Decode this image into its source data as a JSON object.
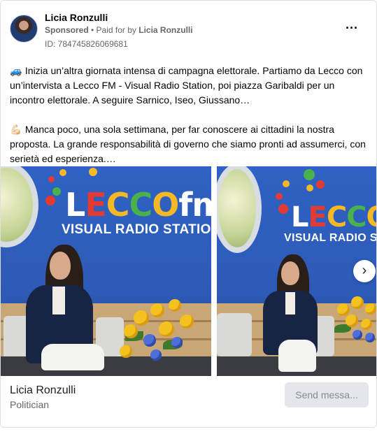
{
  "post": {
    "author": "Licia Ronzulli",
    "sponsored_label": "Sponsored",
    "separator": " • ",
    "paid_for_prefix": "Paid for by ",
    "paid_for_name": "Licia Ronzulli",
    "ad_id": "ID: 784745826069681",
    "more_label": "···",
    "paragraphs": [
      {
        "emoji": "🚙",
        "text": "Inizia un’altra giornata intensa di campagna elettorale. Partiamo da Lecco con un’intervista a Lecco FM - Visual Radio Station, poi piazza Garibaldi per un incontro elettorale. A seguire Sarnico, Iseo, Giussano…"
      },
      {
        "emoji": "💪🏻",
        "text": "Manca poco, una sola settimana, per far conoscere ai cittadini la nostra proposta. La grande responsabilità di governo che siamo pronti ad assumerci, con serietà ed esperienza.…"
      }
    ]
  },
  "carousel": {
    "logo_letters": [
      "L",
      "E",
      "C",
      "C",
      "O",
      "fm"
    ],
    "logo_subtitle_1": "VISUAL RADIO STATION",
    "logo_subtitle_2": "VISUAL RADIO STATION",
    "next_label": "›",
    "colors": {
      "wall": "#2f62c4",
      "logo_red": "#e23b34",
      "logo_yellow": "#f6b925",
      "logo_green": "#49b24a"
    }
  },
  "footer": {
    "page_name": "Licia Ronzulli",
    "category": "Politician",
    "cta_label": "Send messa..."
  }
}
